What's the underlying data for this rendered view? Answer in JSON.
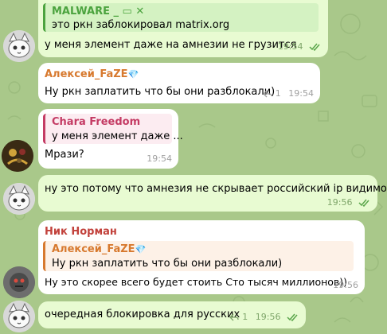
{
  "messages": [
    {
      "quote_author": "MALWARE _ ▭ ✕",
      "quote_text": "это ркн заблокировал matrix.org",
      "text": "у меня элемент даже на амнезии не грузится",
      "time": "19:54"
    },
    {
      "author": "Алексей_FaZE",
      "author_badge": "💎",
      "text": "Ну ркн заплатить что бы они разблокали)",
      "replies": "1",
      "time": "19:54"
    },
    {
      "quote_author": "Chara Freedom",
      "quote_text": "у меня элемент даже ...",
      "text": "Мрази?",
      "time": "19:54"
    },
    {
      "text": "ну это потому что амнезия не скрывает российский ip видимо",
      "time": "19:56"
    },
    {
      "author": "Ник Норман",
      "quote_author": "Алексей_FaZE",
      "quote_badge": "💎",
      "quote_text": "Ну ркн заплатить что бы они разблокали)",
      "text": "Ну это скорее всего будет стоить Сто тысяч миллионов))",
      "time": "19:56"
    },
    {
      "text": "очередная блокировка для русских",
      "replies": "1",
      "time": "19:56"
    }
  ],
  "colors": {
    "wallpaper": "#a9c88a",
    "outgoing_bubble": "#e8fbd2",
    "incoming_bubble": "#ffffff",
    "malware_green": "#4ba33e",
    "aleksey_orange": "#d7792e",
    "chara_pink": "#c43b64",
    "nik_red": "#c2413b",
    "time_green": "#7fa66a"
  }
}
